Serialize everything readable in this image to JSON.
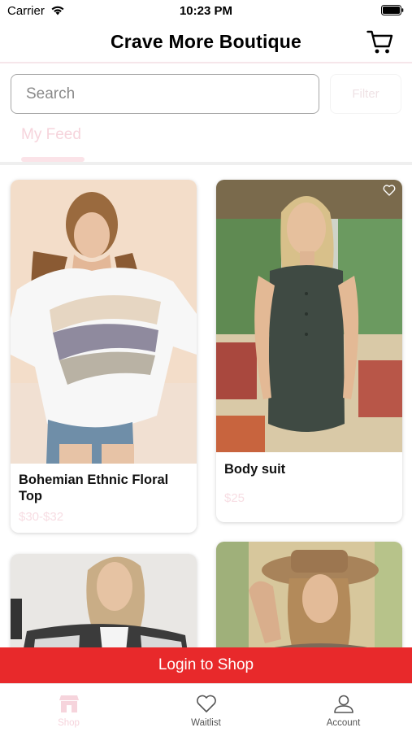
{
  "status_bar": {
    "carrier": "Carrier",
    "time": "10:23 PM"
  },
  "nav": {
    "title": "Crave More Boutique",
    "cart_icon": "cart-icon"
  },
  "search": {
    "placeholder": "Search"
  },
  "filter": {
    "label": "Filter"
  },
  "tabs": {
    "feed": "My Feed"
  },
  "products": [
    {
      "name": "Bohemian Ethnic Floral Top",
      "price": "$30-$32",
      "image": "woman-in-white-paisley-sweater"
    },
    {
      "name": "Body suit",
      "price": "$25",
      "image": "woman-in-dark-green-bodysuit"
    },
    {
      "name": "",
      "price": "",
      "image": "woman-in-plaid-shacket"
    },
    {
      "name": "",
      "price": "",
      "image": "woman-in-brown-hat"
    }
  ],
  "login": {
    "label": "Login to Shop"
  },
  "tab_bar": {
    "shop": "Shop",
    "waitlist": "Waitlist",
    "account": "Account"
  },
  "colors": {
    "brand_red": "#e8292b",
    "pink_accent": "#f6d4dc"
  }
}
